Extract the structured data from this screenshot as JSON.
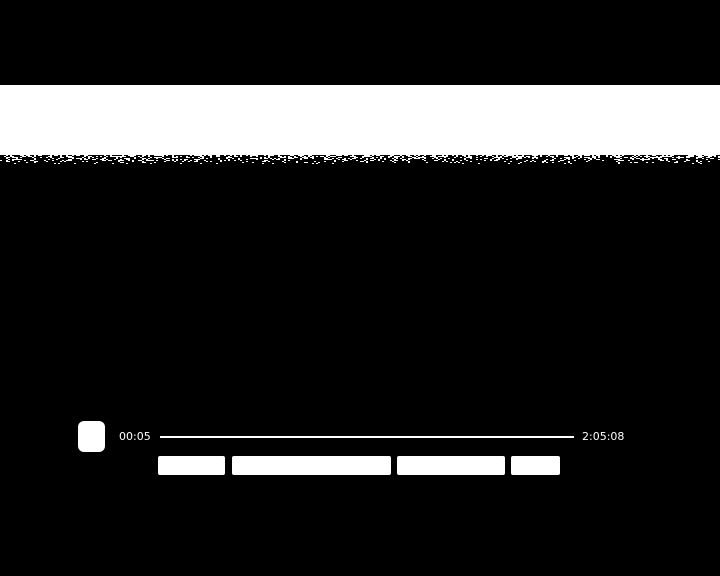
{
  "player": {
    "current_time": "00:05",
    "total_time": "2:05:08",
    "progress_fraction": 0.0007,
    "colors": {
      "background": "#000000",
      "controls": "#ffffff"
    },
    "icons": {
      "play": "play-pause-icon"
    },
    "buttons": [
      {
        "label": ""
      },
      {
        "label": ""
      },
      {
        "label": ""
      },
      {
        "label": ""
      }
    ]
  }
}
